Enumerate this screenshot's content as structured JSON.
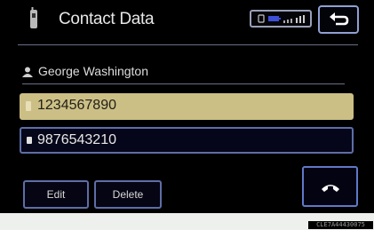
{
  "header": {
    "title": "Contact Data",
    "status_icons": [
      "phone-icon",
      "battery-icon",
      "signal-bars-icon"
    ],
    "back_icon": "back-arrow-icon"
  },
  "contact": {
    "name_icon": "person-icon",
    "name": "George Washington",
    "numbers": [
      {
        "icon": "mobile-phone-icon",
        "value": "1234567890",
        "selected": true
      },
      {
        "icon": "mobile-phone-icon",
        "value": "9876543210",
        "selected": false
      }
    ]
  },
  "actions": {
    "edit_label": "Edit",
    "delete_label": "Delete",
    "call_icon": "handset-icon"
  },
  "footer": {
    "code": "CLE7A44430075"
  },
  "colors": {
    "background": "#000000",
    "selected_row": "#ccbf86",
    "border": "#5e6ea6",
    "text": "#e6e6e6"
  }
}
